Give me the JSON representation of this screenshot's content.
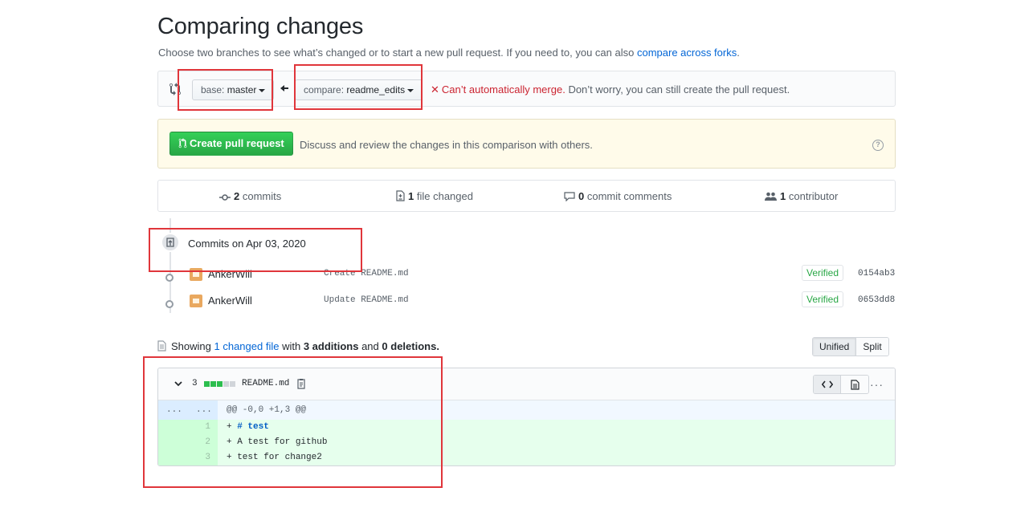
{
  "page": {
    "title": "Comparing changes",
    "subtitle": "Choose two branches to see what’s changed or to start a new pull request. If you need to, you can also ",
    "subtitle_link": "compare across forks",
    "subtitle_end": "."
  },
  "range": {
    "base_key": "base:",
    "base_value": "master",
    "compare_key": "compare:",
    "compare_value": "readme_edits",
    "merge_error": "Can’t automatically merge.",
    "merge_note": "Don’t worry, you can still create the pull request."
  },
  "pull_request": {
    "button_label": "Create pull request",
    "description": "Discuss and review the changes in this comparison with others."
  },
  "stats": {
    "commits_count": "2",
    "commits_label": "commits",
    "files_count": "1",
    "files_label": "file changed",
    "comments_count": "0",
    "comments_label": "commit comments",
    "contributors_count": "1",
    "contributors_label": "contributor"
  },
  "commits": {
    "group_title": "Commits on Apr 03, 2020",
    "items": [
      {
        "author": "AnkerWill",
        "message": "Create README.md",
        "badge": "Verified",
        "sha": "0154ab3"
      },
      {
        "author": "AnkerWill",
        "message": "Update README.md",
        "badge": "Verified",
        "sha": "0653dd8"
      }
    ]
  },
  "file_summary": {
    "prefix": "Showing",
    "link": "1 changed file",
    "with": "with",
    "additions": "3 additions",
    "and": "and",
    "deletions": "0 deletions."
  },
  "diff_view": {
    "unified": "Unified",
    "split": "Split"
  },
  "file": {
    "change_count": "3",
    "name": "README.md",
    "diffstat": {
      "additions": 3,
      "neutral": 2
    },
    "hunk": {
      "left": "...",
      "right": "...",
      "header": "@@ -0,0 +1,3 @@"
    },
    "lines": [
      {
        "num": "1",
        "prefix": "+ ",
        "text": "# test"
      },
      {
        "num": "2",
        "prefix": "+ ",
        "text": "A test for github"
      },
      {
        "num": "3",
        "prefix": "+ ",
        "text": "test for change2"
      }
    ]
  },
  "colors": {
    "link": "#0366d6",
    "create_button": "#28a745",
    "error": "#cb2431",
    "annotation_box": "#e0363b",
    "added_line_bg": "#e6ffed"
  }
}
